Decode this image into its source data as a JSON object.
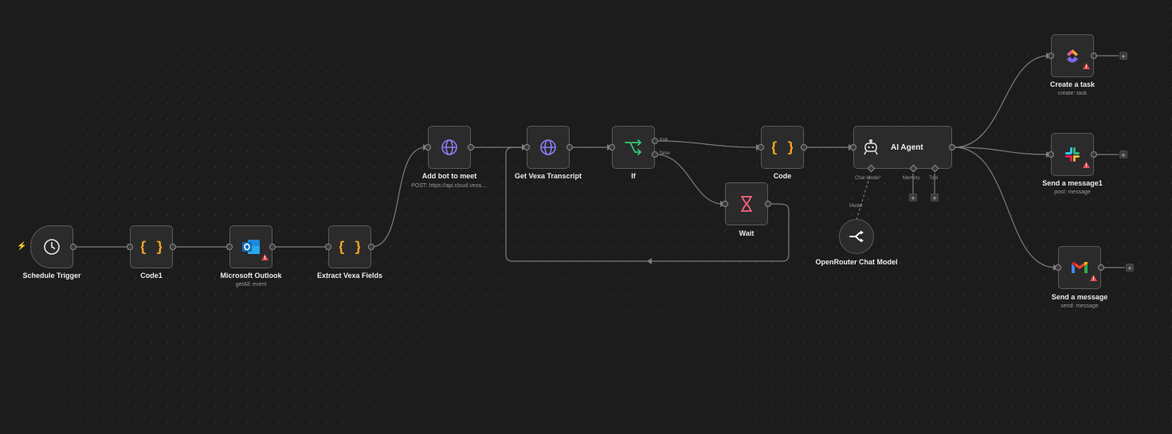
{
  "nodes": {
    "schedule_trigger": {
      "label": "Schedule Trigger"
    },
    "code1": {
      "label": "Code1"
    },
    "outlook": {
      "label": "Microsoft Outlook",
      "sub": "getAll: event"
    },
    "extract": {
      "label": "Extract Vexa Fields"
    },
    "addbot": {
      "label": "Add bot to meet",
      "sub": "POST: https://api.cloud.vexa...."
    },
    "transcript": {
      "label": "Get Vexa Transcript"
    },
    "if": {
      "label": "If",
      "true_label": "true",
      "false_label": "false"
    },
    "wait": {
      "label": "Wait"
    },
    "code": {
      "label": "Code"
    },
    "agent": {
      "label": "AI Agent",
      "chat_model": "Chat Model",
      "chat_model_required": "*",
      "memory": "Memory",
      "tool": "Tool"
    },
    "openrouter": {
      "label": "OpenRouter Chat Model",
      "port_label": "Model"
    },
    "clickup": {
      "label": "Create a task",
      "sub": "create: task"
    },
    "slack": {
      "label": "Send a message1",
      "sub": "post: message"
    },
    "gmail": {
      "label": "Send a message",
      "sub": "send: message"
    }
  },
  "plus_symbol": "+",
  "bolt_symbol": "⚡",
  "colors": {
    "code_brace": "#f5a623",
    "http_globe": "#8b7cf6",
    "if_green": "#34c77b",
    "wait_pink": "#f0607a",
    "warning": "#e5484d",
    "outlook_blue": "#0f6cbd"
  }
}
